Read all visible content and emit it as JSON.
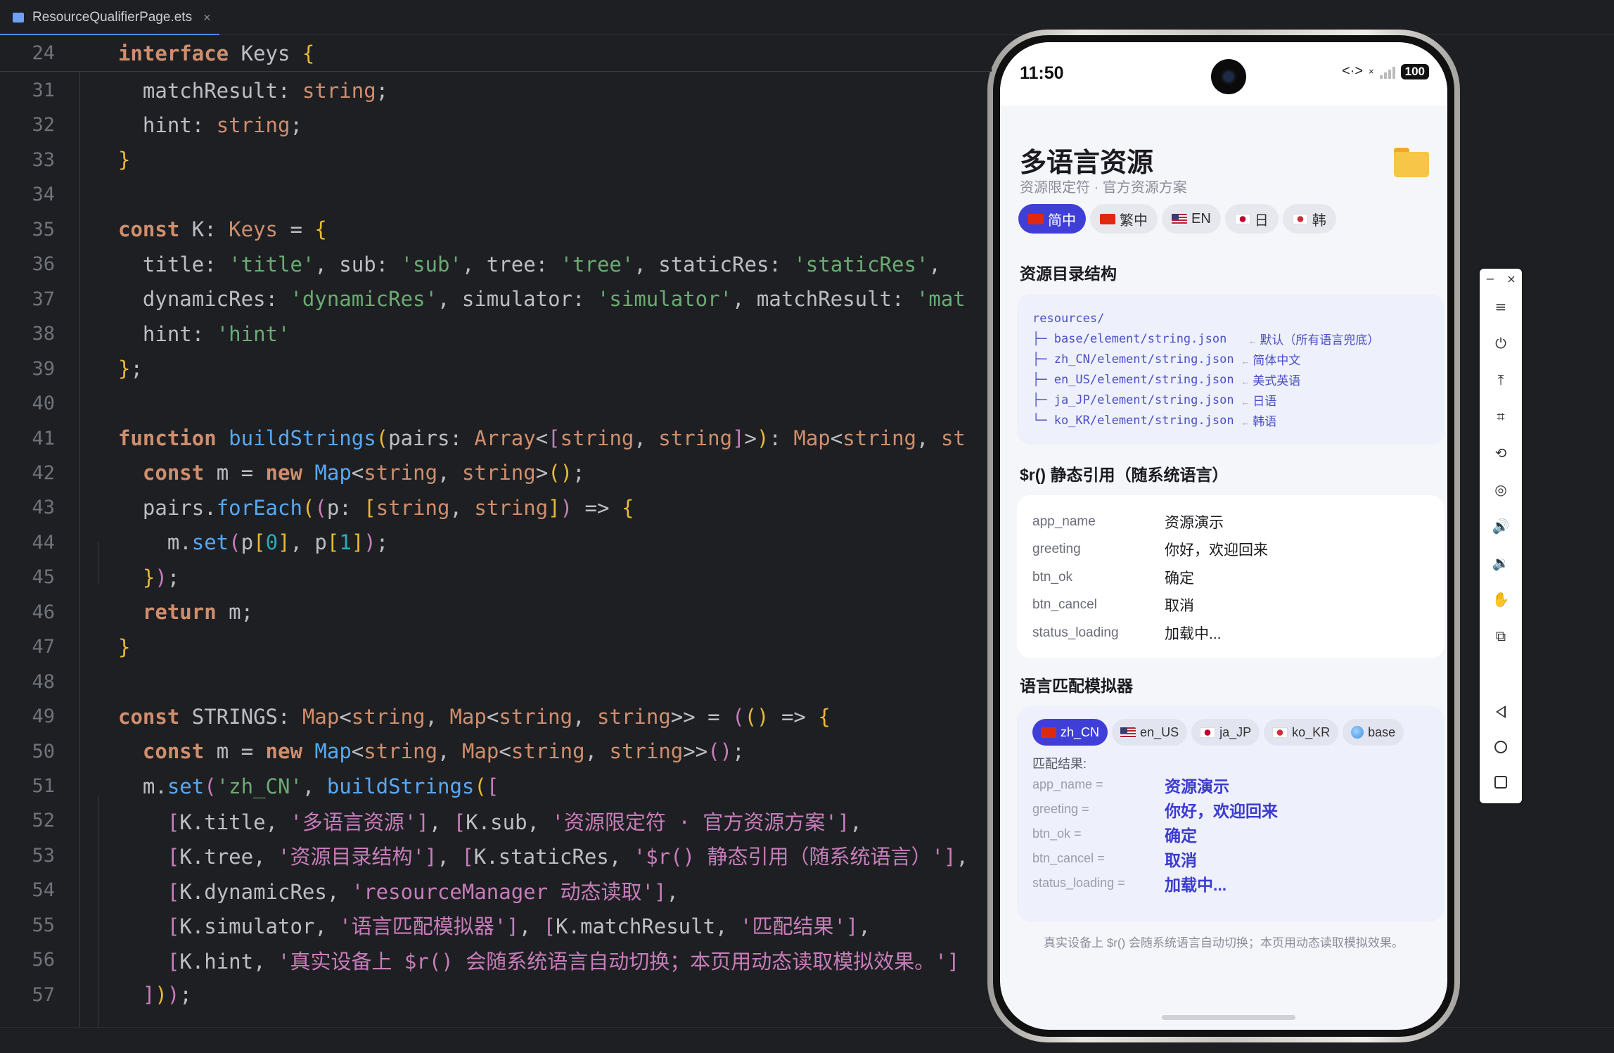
{
  "editor": {
    "tab": {
      "filename": "ResourceQualifierPage.ets",
      "close": "×"
    },
    "sticky": {
      "ln": "24",
      "tokens": [
        [
          "kw",
          "interface"
        ],
        [
          "pr",
          " Keys "
        ],
        [
          "br",
          "{"
        ]
      ]
    },
    "lines": [
      {
        "ln": "31",
        "tokens": [
          [
            "pr",
            "  matchResult: "
          ],
          [
            "tp",
            "string"
          ],
          [
            "pr",
            ";"
          ]
        ]
      },
      {
        "ln": "32",
        "tokens": [
          [
            "pr",
            "  hint: "
          ],
          [
            "tp",
            "string"
          ],
          [
            "pr",
            ";"
          ]
        ]
      },
      {
        "ln": "33",
        "tokens": [
          [
            "br",
            "}"
          ]
        ]
      },
      {
        "ln": "34",
        "tokens": []
      },
      {
        "ln": "35",
        "tokens": [
          [
            "kw",
            "const"
          ],
          [
            "pr",
            " K: "
          ],
          [
            "tp",
            "Keys"
          ],
          [
            "pr",
            " = "
          ],
          [
            "br",
            "{"
          ]
        ]
      },
      {
        "ln": "36",
        "tokens": [
          [
            "pr",
            "  title: "
          ],
          [
            "st",
            "'title'"
          ],
          [
            "pr",
            ", sub: "
          ],
          [
            "st",
            "'sub'"
          ],
          [
            "pr",
            ", tree: "
          ],
          [
            "st",
            "'tree'"
          ],
          [
            "pr",
            ", staticRes: "
          ],
          [
            "st",
            "'staticRes'"
          ],
          [
            "pr",
            ","
          ]
        ]
      },
      {
        "ln": "37",
        "tokens": [
          [
            "pr",
            "  dynamicRes: "
          ],
          [
            "st",
            "'dynamicRes'"
          ],
          [
            "pr",
            ", simulator: "
          ],
          [
            "st",
            "'simulator'"
          ],
          [
            "pr",
            ", matchResult: "
          ],
          [
            "st",
            "'mat"
          ]
        ]
      },
      {
        "ln": "38",
        "tokens": [
          [
            "pr",
            "  hint: "
          ],
          [
            "st",
            "'hint'"
          ]
        ]
      },
      {
        "ln": "39",
        "tokens": [
          [
            "br",
            "}"
          ],
          [
            "pr",
            ";"
          ]
        ]
      },
      {
        "ln": "40",
        "tokens": []
      },
      {
        "ln": "41",
        "tokens": [
          [
            "kw",
            "function"
          ],
          [
            "pr",
            " "
          ],
          [
            "fn",
            "buildStrings"
          ],
          [
            "br",
            "("
          ],
          [
            "pr",
            "pairs: "
          ],
          [
            "tp",
            "Array"
          ],
          [
            "pr",
            "<"
          ],
          [
            "br2",
            "["
          ],
          [
            "tp",
            "string"
          ],
          [
            "pr",
            ", "
          ],
          [
            "tp",
            "string"
          ],
          [
            "br2",
            "]"
          ],
          [
            "pr",
            ">"
          ],
          [
            "br",
            ")"
          ],
          [
            "pr",
            ": "
          ],
          [
            "tp",
            "Map"
          ],
          [
            "pr",
            "<"
          ],
          [
            "tp",
            "string"
          ],
          [
            "pr",
            ", "
          ],
          [
            "tp",
            "st"
          ]
        ]
      },
      {
        "ln": "42",
        "tokens": [
          [
            "pr",
            "  "
          ],
          [
            "kw",
            "const"
          ],
          [
            "pr",
            " m = "
          ],
          [
            "kw",
            "new"
          ],
          [
            "pr",
            " "
          ],
          [
            "fn",
            "Map"
          ],
          [
            "pr",
            "<"
          ],
          [
            "tp",
            "string"
          ],
          [
            "pr",
            ", "
          ],
          [
            "tp",
            "string"
          ],
          [
            "pr",
            ">"
          ],
          [
            "br",
            "()"
          ],
          [
            "pr",
            ";"
          ]
        ]
      },
      {
        "ln": "43",
        "tokens": [
          [
            "pr",
            "  pairs."
          ],
          [
            "fn",
            "forEach"
          ],
          [
            "br",
            "("
          ],
          [
            "br2",
            "("
          ],
          [
            "pr",
            "p: "
          ],
          [
            "br",
            "["
          ],
          [
            "tp",
            "string"
          ],
          [
            "pr",
            ", "
          ],
          [
            "tp",
            "string"
          ],
          [
            "br",
            "]"
          ],
          [
            "br2",
            ")"
          ],
          [
            "pr",
            " => "
          ],
          [
            "br",
            "{"
          ]
        ]
      },
      {
        "ln": "44",
        "tokens": [
          [
            "pr",
            "    m."
          ],
          [
            "fn",
            "set"
          ],
          [
            "br2",
            "("
          ],
          [
            "pr",
            "p"
          ],
          [
            "br",
            "["
          ],
          [
            "nm",
            "0"
          ],
          [
            "br",
            "]"
          ],
          [
            "pr",
            ", p"
          ],
          [
            "br",
            "["
          ],
          [
            "nm",
            "1"
          ],
          [
            "br",
            "]"
          ],
          [
            "br2",
            ")"
          ],
          [
            "pr",
            ";"
          ]
        ]
      },
      {
        "ln": "45",
        "tokens": [
          [
            "pr",
            "  "
          ],
          [
            "br",
            "}"
          ],
          [
            "br2",
            ")"
          ],
          [
            "pr",
            ";"
          ]
        ]
      },
      {
        "ln": "46",
        "tokens": [
          [
            "pr",
            "  "
          ],
          [
            "kw",
            "return"
          ],
          [
            "pr",
            " m;"
          ]
        ]
      },
      {
        "ln": "47",
        "tokens": [
          [
            "br",
            "}"
          ]
        ]
      },
      {
        "ln": "48",
        "tokens": []
      },
      {
        "ln": "49",
        "tokens": [
          [
            "kw",
            "const"
          ],
          [
            "pr",
            " STRINGS: "
          ],
          [
            "tp",
            "Map"
          ],
          [
            "pr",
            "<"
          ],
          [
            "tp",
            "string"
          ],
          [
            "pr",
            ", "
          ],
          [
            "tp",
            "Map"
          ],
          [
            "pr",
            "<"
          ],
          [
            "tp",
            "string"
          ],
          [
            "pr",
            ", "
          ],
          [
            "tp",
            "string"
          ],
          [
            "pr",
            ">> = "
          ],
          [
            "br2",
            "("
          ],
          [
            "br",
            "()"
          ],
          [
            "pr",
            " => "
          ],
          [
            "br",
            "{"
          ]
        ]
      },
      {
        "ln": "50",
        "tokens": [
          [
            "pr",
            "  "
          ],
          [
            "kw",
            "const"
          ],
          [
            "pr",
            " m = "
          ],
          [
            "kw",
            "new"
          ],
          [
            "pr",
            " "
          ],
          [
            "fn",
            "Map"
          ],
          [
            "pr",
            "<"
          ],
          [
            "tp",
            "string"
          ],
          [
            "pr",
            ", "
          ],
          [
            "tp",
            "Map"
          ],
          [
            "pr",
            "<"
          ],
          [
            "tp",
            "string"
          ],
          [
            "pr",
            ", "
          ],
          [
            "tp",
            "string"
          ],
          [
            "pr",
            ">>"
          ],
          [
            "br2",
            "()"
          ],
          [
            "pr",
            ";"
          ]
        ]
      },
      {
        "ln": "51",
        "tokens": [
          [
            "pr",
            "  m."
          ],
          [
            "fn",
            "set"
          ],
          [
            "br2",
            "("
          ],
          [
            "st",
            "'zh_CN'"
          ],
          [
            "pr",
            ", "
          ],
          [
            "fn",
            "buildStrings"
          ],
          [
            "br",
            "("
          ],
          [
            "br2",
            "["
          ]
        ]
      },
      {
        "ln": "52",
        "tokens": [
          [
            "pr",
            "    "
          ],
          [
            "br2",
            "["
          ],
          [
            "pr",
            "K.title, "
          ],
          [
            "st2",
            "'多语言资源'"
          ],
          [
            "br2",
            "]"
          ],
          [
            "pr",
            ", "
          ],
          [
            "br2",
            "["
          ],
          [
            "pr",
            "K.sub, "
          ],
          [
            "st2",
            "'资源限定符 · 官方资源方案'"
          ],
          [
            "br2",
            "]"
          ],
          [
            "pr",
            ","
          ]
        ]
      },
      {
        "ln": "53",
        "tokens": [
          [
            "pr",
            "    "
          ],
          [
            "br2",
            "["
          ],
          [
            "pr",
            "K.tree, "
          ],
          [
            "st2",
            "'资源目录结构'"
          ],
          [
            "br2",
            "]"
          ],
          [
            "pr",
            ", "
          ],
          [
            "br2",
            "["
          ],
          [
            "pr",
            "K.staticRes, "
          ],
          [
            "st2",
            "'$r() 静态引用（随系统语言）'"
          ],
          [
            "br2",
            "]"
          ],
          [
            "pr",
            ","
          ]
        ]
      },
      {
        "ln": "54",
        "tokens": [
          [
            "pr",
            "    "
          ],
          [
            "br2",
            "["
          ],
          [
            "pr",
            "K.dynamicRes, "
          ],
          [
            "st2",
            "'resourceManager 动态读取'"
          ],
          [
            "br2",
            "]"
          ],
          [
            "pr",
            ","
          ]
        ]
      },
      {
        "ln": "55",
        "tokens": [
          [
            "pr",
            "    "
          ],
          [
            "br2",
            "["
          ],
          [
            "pr",
            "K.simulator, "
          ],
          [
            "st2",
            "'语言匹配模拟器'"
          ],
          [
            "br2",
            "]"
          ],
          [
            "pr",
            ", "
          ],
          [
            "br2",
            "["
          ],
          [
            "pr",
            "K.matchResult, "
          ],
          [
            "st2",
            "'匹配结果'"
          ],
          [
            "br2",
            "]"
          ],
          [
            "pr",
            ","
          ]
        ]
      },
      {
        "ln": "56",
        "tokens": [
          [
            "pr",
            "    "
          ],
          [
            "br2",
            "["
          ],
          [
            "pr",
            "K.hint, "
          ],
          [
            "st2",
            "'真实设备上 $r() 会随系统语言自动切换；本页用动态读取模拟效果。'"
          ],
          [
            "br2",
            "]"
          ]
        ]
      },
      {
        "ln": "57",
        "tokens": [
          [
            "pr",
            "  "
          ],
          [
            "br2",
            "]"
          ],
          [
            "br",
            ")"
          ],
          [
            "br2",
            ")"
          ],
          [
            "pr",
            ";"
          ]
        ]
      }
    ]
  },
  "phone": {
    "status": {
      "time": "11:50",
      "battery": "100",
      "net": "<·>",
      "x": "×"
    },
    "title": "多语言资源",
    "subtitle": "资源限定符 · 官方资源方案",
    "lang_tabs": [
      {
        "label": "简中",
        "flag": "flag-cn",
        "active": true
      },
      {
        "label": "繁中",
        "flag": "flag-hk",
        "active": false
      },
      {
        "label": "EN",
        "flag": "flag-us",
        "active": false
      },
      {
        "label": "日",
        "flag": "flag-jp",
        "active": false
      },
      {
        "label": "韩",
        "flag": "flag-kr",
        "active": false
      }
    ],
    "tree_title": "资源目录结构",
    "tree": [
      {
        "path": "resources/",
        "note": ""
      },
      {
        "path": "├─ base/element/string.json  ",
        "note": "默认（所有语言兜底）"
      },
      {
        "path": "├─ zh_CN/element/string.json",
        "note": "简体中文"
      },
      {
        "path": "├─ en_US/element/string.json",
        "note": "美式英语"
      },
      {
        "path": "├─ ja_JP/element/string.json",
        "note": "日语"
      },
      {
        "path": "└─ ko_KR/element/string.json",
        "note": "韩语"
      }
    ],
    "tree_arrow": "←",
    "static_title": "$r() 静态引用（随系统语言）",
    "static_rows": [
      {
        "key": "app_name",
        "value": "资源演示"
      },
      {
        "key": "greeting",
        "value": "你好，欢迎回来"
      },
      {
        "key": "btn_ok",
        "value": "确定"
      },
      {
        "key": "btn_cancel",
        "value": "取消"
      },
      {
        "key": "status_loading",
        "value": "加载中..."
      }
    ],
    "sim_title": "语言匹配模拟器",
    "sim_chips": [
      {
        "label": "zh_CN",
        "flag": "flag-cn",
        "active": true
      },
      {
        "label": "en_US",
        "flag": "flag-us",
        "active": false
      },
      {
        "label": "ja_JP",
        "flag": "flag-jp",
        "active": false
      },
      {
        "label": "ko_KR",
        "flag": "flag-kr",
        "active": false
      },
      {
        "label": "base",
        "flag": "globe",
        "active": false
      }
    ],
    "match_label": "匹配结果:",
    "match_rows": [
      {
        "key": "app_name =",
        "value": "资源演示"
      },
      {
        "key": "greeting =",
        "value": "你好，欢迎回来"
      },
      {
        "key": "btn_ok =",
        "value": "确定"
      },
      {
        "key": "btn_cancel =",
        "value": "取消"
      },
      {
        "key": "status_loading =",
        "value": "加载中..."
      }
    ],
    "hint": "真实设备上 $r() 会随系统语言自动切换；本页用动态读取模拟效果。"
  },
  "emulator_toolbar": {
    "minimize": "−",
    "close": "×",
    "buttons": [
      {
        "name": "menu-icon",
        "glyph": "≡"
      },
      {
        "name": "power-icon",
        "glyph": "⏻"
      },
      {
        "name": "pin-top-icon",
        "glyph": "⤒"
      },
      {
        "name": "crop-icon",
        "glyph": "⌗"
      },
      {
        "name": "rotate-icon",
        "glyph": "⟲"
      },
      {
        "name": "screenshot-icon",
        "glyph": "◎"
      },
      {
        "name": "volume-up-icon",
        "glyph": "🔊"
      },
      {
        "name": "volume-down-icon",
        "glyph": "🔉"
      },
      {
        "name": "shake-icon",
        "glyph": "✋"
      },
      {
        "name": "multi-screen-icon",
        "glyph": "⧉"
      }
    ]
  }
}
